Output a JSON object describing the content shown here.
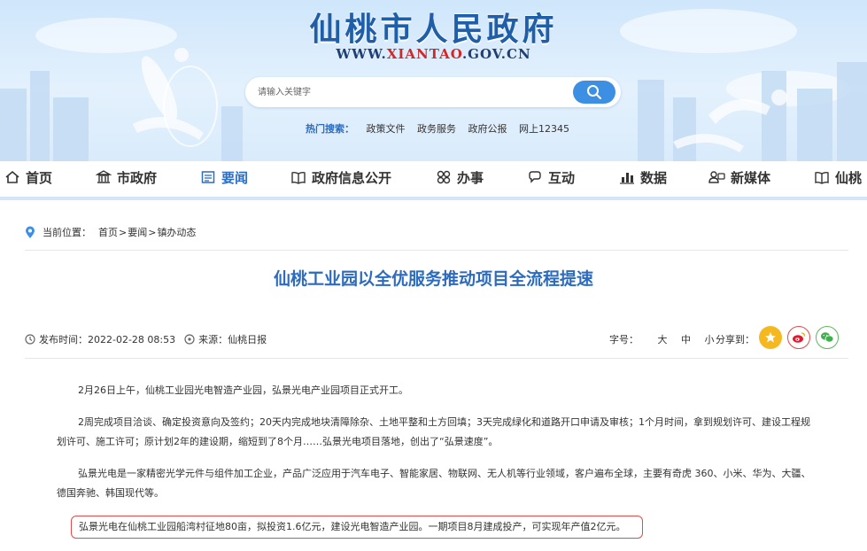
{
  "header": {
    "site_title": "仙桃市人民政府",
    "site_url_prefix": "WWW.",
    "site_url_highlight": "XIANTAO",
    "site_url_suffix": ".GOV.CN",
    "search_placeholder": "请输入关键字",
    "hot_label": "热门搜索：",
    "hot_links": [
      "政策文件",
      "政务服务",
      "政府公报",
      "网上12345"
    ]
  },
  "nav": {
    "items": [
      {
        "label": "首页",
        "icon": "home-icon"
      },
      {
        "label": "市政府",
        "icon": "government-building-icon"
      },
      {
        "label": "要闻",
        "icon": "news-icon",
        "active": true
      },
      {
        "label": "政府信息公开",
        "icon": "book-icon"
      },
      {
        "label": "办事",
        "icon": "service-grid-icon"
      },
      {
        "label": "互动",
        "icon": "interaction-icon"
      },
      {
        "label": "数据",
        "icon": "bar-chart-icon"
      },
      {
        "label": "新媒体",
        "icon": "new-media-icon"
      },
      {
        "label": "仙桃",
        "icon": "book-icon"
      }
    ]
  },
  "breadcrumb": {
    "label": "当前位置：",
    "items": [
      "首页",
      "要闻",
      "镇办动态"
    ],
    "separator": ">"
  },
  "article": {
    "title": "仙桃工业园以全优服务推动项目全流程提速",
    "publish_label": "发布时间：",
    "publish_time": "2022-02-28 08:53",
    "source_label": "来源：",
    "source": "仙桃日报",
    "font_size_label": "字号：",
    "font_sizes": [
      "大",
      "中",
      "小"
    ],
    "share_label": "分享到：",
    "share_targets": [
      "favorite-icon",
      "weibo-icon",
      "wechat-icon"
    ],
    "paragraphs": [
      "2月26日上午，仙桃工业园光电智造产业园，弘景光电产业园项目正式开工。",
      "2周完成项目洽谈、确定投资意向及签约；20天内完成地块清障除杂、土地平整和土方回填；3天完成绿化和道路开口申请及审核；1个月时间，拿到规划许可、建设工程规划许可、施工许可；原计划2年的建设期，缩短到了8个月……弘景光电项目落地，创出了“弘景速度”。",
      "弘景光电是一家精密光学元件与组件加工企业，产品广泛应用于汽车电子、智能家居、物联网、无人机等行业领域，客户遍布全球，主要有奇虎 360、小米、华为、大疆、德国奔驰、韩国现代等。",
      "弘景光电在仙桃工业园船湾村征地80亩，拟投资1.6亿元，建设光电智造产业园。一期项目8月建成投产，可实现年产值2亿元。"
    ]
  },
  "colors": {
    "brand_blue": "#1f5ea8",
    "nav_active": "#2b6cc4",
    "search_button": "#3d8fe3",
    "highlight_box": "#e04b4b"
  }
}
